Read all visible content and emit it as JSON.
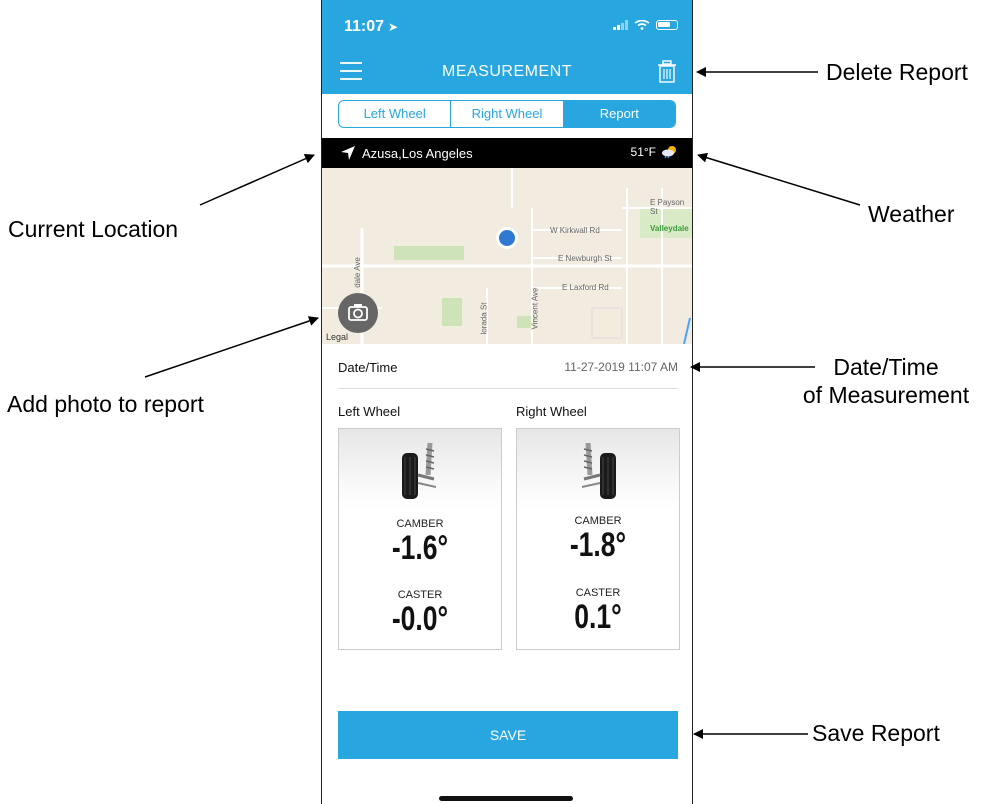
{
  "status_bar": {
    "time": "11:07"
  },
  "nav": {
    "title": "MEASUREMENT"
  },
  "tabs": [
    {
      "label": "Left Wheel",
      "active": false
    },
    {
      "label": "Right Wheel",
      "active": false
    },
    {
      "label": "Report",
      "active": true
    }
  ],
  "location_bar": {
    "location": "Azusa,Los Angeles",
    "temperature": "51°F"
  },
  "map": {
    "street_labels": [
      "E Payson St",
      "Valleydale",
      "W Kirkwall Rd",
      "E Newburgh St",
      "E Laxford Rd",
      "dale Ave",
      "lorada St",
      "Vincent Ave",
      "Legal"
    ]
  },
  "report": {
    "datetime_label": "Date/Time",
    "datetime_value": "11-27-2019 11:07 AM",
    "left": {
      "title": "Left Wheel",
      "camber_label": "CAMBER",
      "camber_value": "-1.6°",
      "caster_label": "CASTER",
      "caster_value": "-0.0°"
    },
    "right": {
      "title": "Right Wheel",
      "camber_label": "CAMBER",
      "camber_value": "-1.8°",
      "caster_label": "CASTER",
      "caster_value": "0.1°"
    }
  },
  "save_label": "SAVE",
  "annotations": {
    "delete_report": "Delete Report",
    "weather": "Weather",
    "current_location": "Current Location",
    "add_photo": "Add photo to report",
    "datetime_line1": "Date/Time",
    "datetime_line2": "of Measurement",
    "save_report": "Save Report"
  },
  "colors": {
    "accent": "#27a6e0",
    "location_bar": "#000000",
    "map_bg": "#f1ecdf",
    "user_dot": "#2f79d3"
  }
}
